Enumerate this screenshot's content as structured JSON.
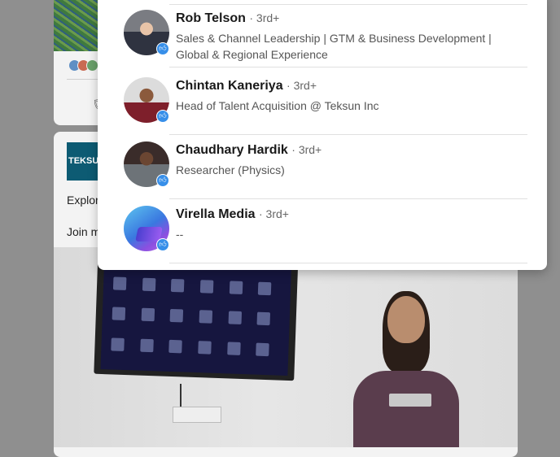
{
  "background": {
    "post_line_1": "Explor",
    "post_line_2": "Join m",
    "brand_logo_text": "TEKSUN"
  },
  "popup": {
    "reactors": [
      {
        "name": "Rob Telson",
        "degree": "· 3rd+",
        "headline": "Sales & Channel Leadership | GTM & Business Development | Global & Regional Experience",
        "reaction": "like-icon"
      },
      {
        "name": "Chintan Kaneriya",
        "degree": "· 3rd+",
        "headline": "Head of Talent Acquisition @ Teksun Inc",
        "reaction": "like-icon"
      },
      {
        "name": "Chaudhary Hardik",
        "degree": "· 3rd+",
        "headline": "Researcher (Physics)",
        "reaction": "like-icon"
      },
      {
        "name": "Virella Media",
        "degree": "· 3rd+",
        "headline": "--",
        "reaction": "like-icon"
      }
    ]
  },
  "colors": {
    "like_badge": "#378fe9",
    "overlay": "#8f8f8f",
    "popup_bg": "#ffffff"
  }
}
